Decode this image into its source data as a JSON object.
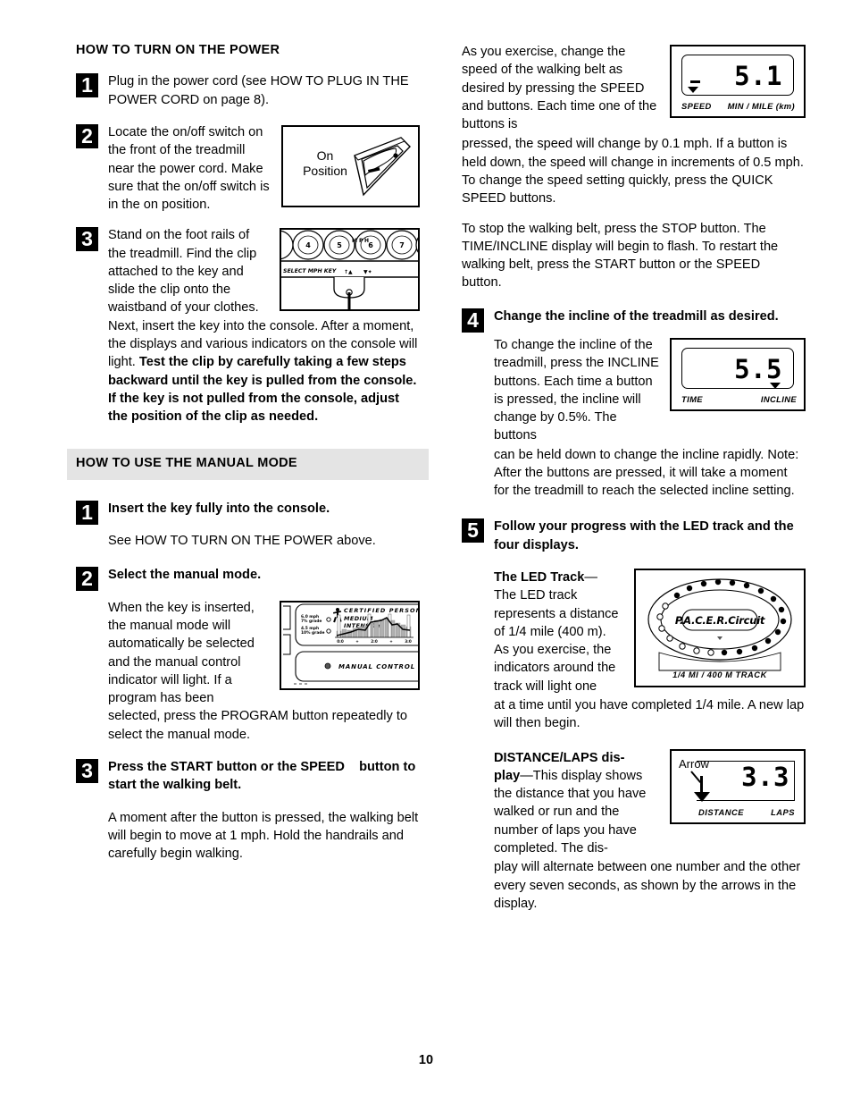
{
  "page": {
    "number": "10"
  },
  "left_column": {
    "heading_power": "HOW TO TURN ON THE POWER",
    "heading_manual": "HOW TO USE THE MANUAL MODE",
    "power_steps": [
      {
        "num": "1",
        "text": "Plug in the power cord (see HOW TO PLUG IN THE POWER CORD on page 8)."
      },
      {
        "num": "2",
        "text": "Locate the on/off switch on the front of the treadmill near the power cord. Make sure that the on/off switch is in the on position."
      },
      {
        "num": "3",
        "text_a": "Stand on the foot rails of the treadmill. Find the clip attached to the key and slide the clip onto the waistband of your clothes. Next, insert the key into the console. After a moment, the displays and various indicators on the console will light. ",
        "text_b": "Test the clip by carefully taking a few steps backward until the key is pulled from the console. If the key is not pulled from the console, adjust the position of the clip as needed."
      }
    ],
    "manual_steps": [
      {
        "num": "1",
        "bold": "Insert the key fully into the console.",
        "body": "See HOW TO TURN ON THE POWER above."
      },
      {
        "num": "2",
        "bold": "Select the manual mode.",
        "body": "When the key is inserted, the manual mode will automatically be selected and the manual control indicator will light. If a program has been selected, press the PROGRAM button repeatedly to select the manual mode."
      },
      {
        "num": "3",
        "bold": "Press the START button or the SPEED    button to start the walking belt.",
        "body": "A moment after the button is pressed, the walking belt will begin to move at 1 mph. Hold the handrails and carefully begin walking."
      }
    ],
    "switch_figure": {
      "line1": "On",
      "line2": "Position"
    },
    "console_figure": {
      "key_label": "SELECT MPH KEY",
      "button_numbers": [
        "4",
        "5",
        "6",
        "7"
      ],
      "mph_marks": [
        "M",
        "P",
        "H"
      ]
    },
    "panel_figure": {
      "title": "CERTIFIED PERSONAL",
      "subtitle1": "MEDIUM",
      "subtitle2": "INTENSITY",
      "legend1_line1": "6.0 mph",
      "legend1_line2": "7% grade",
      "legend2_line1": "4.5 mph",
      "legend2_line2": "10% grade",
      "axis_labels": [
        "0:0",
        "+",
        "2:0",
        "+",
        "3:0"
      ],
      "manual_control": "MANUAL CONTROL"
    }
  },
  "right_column": {
    "speed_paragraph_1": "As you exercise, change the speed of the walking belt as desired by pressing the SPEED    and buttons. Each time one of the buttons is",
    "speed_paragraph_1b": "pressed, the speed will change by 0.1 mph. If a button is held down, the speed will change in increments of 0.5 mph. To change the speed setting quickly, press the QUICK SPEED buttons.",
    "speed_paragraph_2": "To stop the walking belt, press the STOP button. The TIME/INCLINE display will begin to flash. To restart the walking belt, press the START button or the SPEED    button.",
    "steps": [
      {
        "num": "4",
        "bold": "Change the incline of the treadmill as desired.",
        "body_a": "To change the incline of the treadmill, press the INCLINE buttons. Each time a button is pressed, the incline will change by 0.5%. The buttons",
        "body_b": "can be held down to change the incline rapidly. Note: After the buttons are pressed, it will take a moment for the treadmill to reach the selected incline setting."
      },
      {
        "num": "5",
        "bold": "Follow your progress with the LED track and the four displays."
      }
    ],
    "led_track": {
      "lead_bold": "The LED Track",
      "dash": "—",
      "body_a": "The LED track represents a distance of 1/4 mile (400 m). As you exercise, the indicators around the track will light one",
      "body_b": "at a time until you have completed 1/4 mile. A new lap will then begin."
    },
    "distance_laps": {
      "lead_bold_1": "DISTANCE/LAPS dis-",
      "lead_bold_2": "play",
      "dash": "—",
      "body_a": "This display shows the distance that you have walked or run and the number of laps you have completed. The dis-",
      "body_b": "play will alternate between one number and the other every seven seconds, as shown by the arrows in the display."
    },
    "speed_display": {
      "value": "5.1",
      "label_left": "SPEED",
      "label_right": "MIN / MILE (km)"
    },
    "incline_display": {
      "value": "5.5",
      "label_left": "TIME",
      "label_right": "INCLINE"
    },
    "distance_display": {
      "value": "3.3",
      "arrow_label": "Arrow",
      "label_left": "DISTANCE",
      "label_right": "LAPS"
    },
    "track_figure": {
      "brand": "P.A.C.E.R.Circuit",
      "caption": "1/4 MI / 400 M TRACK"
    }
  }
}
